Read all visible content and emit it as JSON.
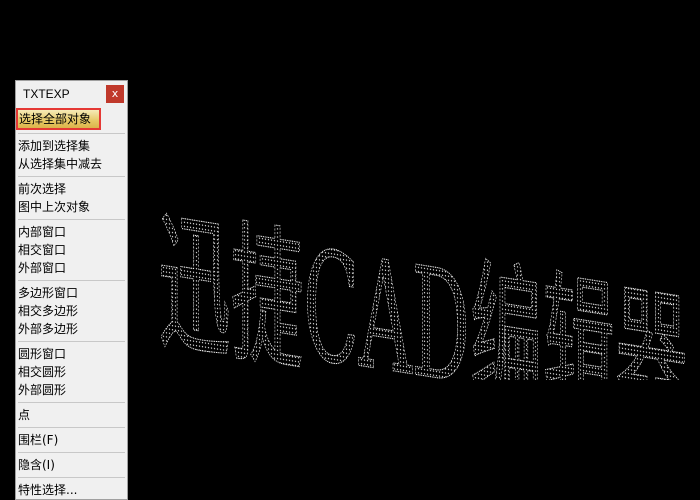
{
  "panel": {
    "title": "TXTEXP",
    "close_glyph": "x",
    "groups": [
      [
        "选择全部对象"
      ],
      [
        "添加到选择集",
        "从选择集中减去"
      ],
      [
        "前次选择",
        "图中上次对象"
      ],
      [
        "内部窗口",
        "相交窗口",
        "外部窗口"
      ],
      [
        "多边形窗口",
        "相交多边形",
        "外部多边形"
      ],
      [
        "圆形窗口",
        "相交圆形",
        "外部圆形"
      ],
      [
        "点"
      ],
      [
        "围栏(F)"
      ],
      [
        "隐含(I)"
      ],
      [
        "特性选择..."
      ]
    ],
    "selected_item": "选择全部对象"
  },
  "canvas": {
    "exploded_text": "迅捷CAD编辑器",
    "background_color": "#000000",
    "text_color": "#ffffff"
  }
}
